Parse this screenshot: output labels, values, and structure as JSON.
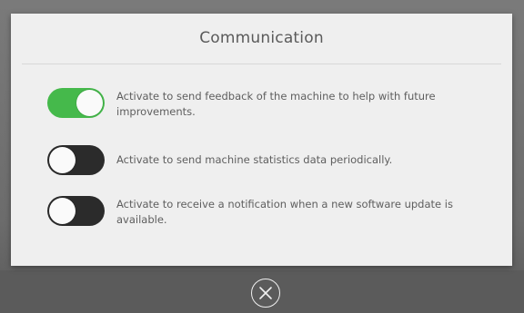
{
  "dialog": {
    "title": "Communication",
    "settings": [
      {
        "label": "Activate to send feedback of the machine to help with future improvements.",
        "enabled": true
      },
      {
        "label": "Activate to send machine statistics data periodically.",
        "enabled": false
      },
      {
        "label": "Activate to receive a notification when a new software update is available.",
        "enabled": false
      }
    ]
  },
  "footer": {
    "close_icon": "close-icon"
  },
  "colors": {
    "toggle_on": "#45b94b",
    "toggle_off": "#2b2b2b",
    "dialog_bg": "#efefef",
    "backdrop": "#6c6c6c"
  }
}
